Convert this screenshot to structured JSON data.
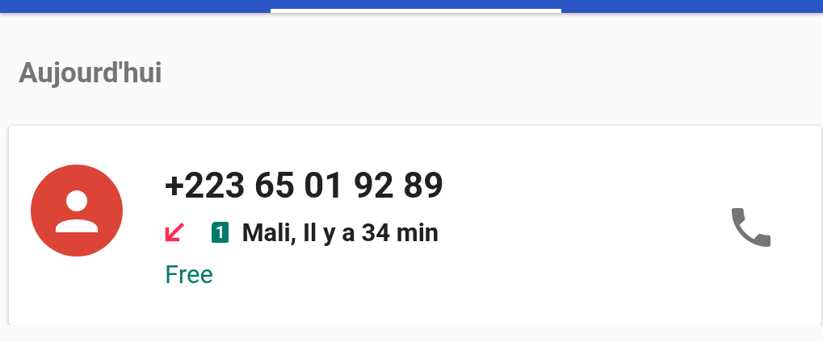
{
  "tabs": [
    {
      "selected": false
    },
    {
      "selected": true
    },
    {
      "selected": false
    }
  ],
  "section_header": "Aujourd'hui",
  "calls": [
    {
      "number": "+223 65 01 92 89",
      "kind": "missed",
      "sim": "1",
      "details": "Mali, Il y a 34 min",
      "label": "Free"
    }
  ]
}
